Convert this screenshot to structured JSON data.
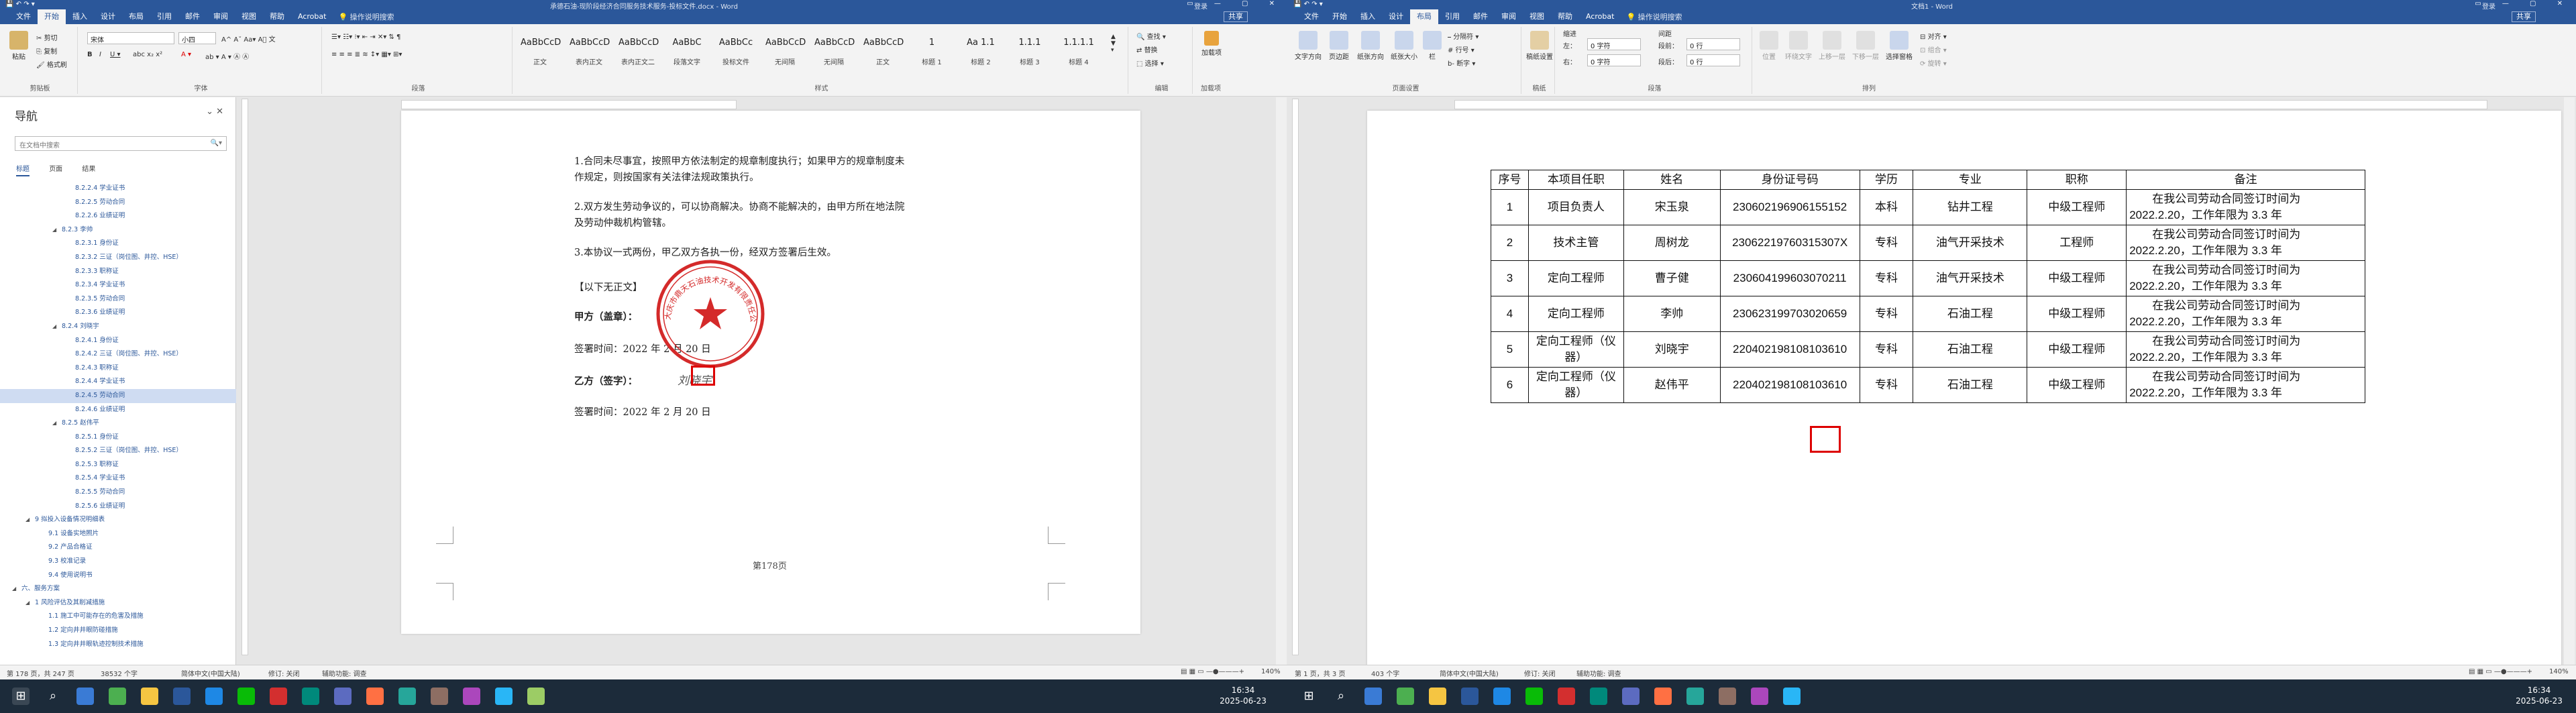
{
  "left": {
    "title": "承德石油-现阶段经济合同服务技术服务-投标文件.docx - Word",
    "login": "登录",
    "share": "共享",
    "tabs": [
      "文件",
      "开始",
      "插入",
      "设计",
      "布局",
      "引用",
      "邮件",
      "审阅",
      "视图",
      "帮助",
      "Acrobat"
    ],
    "tell_me": "操作说明搜索",
    "ribbon": {
      "clipboard": "剪贴板",
      "paste": "粘贴",
      "cut": "剪切",
      "copy": "复制",
      "format_painter": "格式刷",
      "font": "字体",
      "font_name": "宋体",
      "font_size": "小四",
      "paragraph": "段落",
      "styles_label": "样式",
      "styles": [
        {
          "preview": "AaBbCcD",
          "name": "正文"
        },
        {
          "preview": "AaBbCcD",
          "name": "表内正文"
        },
        {
          "preview": "AaBbCcD",
          "name": "表内正文二"
        },
        {
          "preview": "AaBbC",
          "name": "段落文字"
        },
        {
          "preview": "AaBbCc",
          "name": "投标文件"
        },
        {
          "preview": "AaBbCcD",
          "name": "无间隔"
        },
        {
          "preview": "AaBbCcD",
          "name": "无间隔"
        },
        {
          "preview": "AaBbCcD",
          "name": "正文"
        },
        {
          "preview": "1",
          "name": "标题 1"
        },
        {
          "preview": "Aa 1.1",
          "name": "标题 2"
        },
        {
          "preview": "1.1.1",
          "name": "标题 3"
        },
        {
          "preview": "1.1.1.1",
          "name": "标题 4"
        }
      ],
      "editing": "编辑",
      "find": "查找",
      "replace": "替换",
      "select": "选择",
      "addin": "加载项",
      "addin_btn": "加载项"
    },
    "nav": {
      "title": "导航",
      "search_placeholder": "在文档中搜索",
      "tabs": [
        "标题",
        "页面",
        "结果"
      ],
      "items": [
        {
          "text": "8.2.2.4 学业证书",
          "level": 4
        },
        {
          "text": "8.2.2.5 劳动合同",
          "level": 4
        },
        {
          "text": "8.2.2.6 业绩证明",
          "level": 4
        },
        {
          "text": "8.2.3 李帅",
          "level": 3,
          "open": true
        },
        {
          "text": "8.2.3.1 身份证",
          "level": 4
        },
        {
          "text": "8.2.3.2 三证（岗位图、井控、HSE）",
          "level": 4
        },
        {
          "text": "8.2.3.3 职称证",
          "level": 4
        },
        {
          "text": "8.2.3.4 学业证书",
          "level": 4
        },
        {
          "text": "8.2.3.5 劳动合同",
          "level": 4
        },
        {
          "text": "8.2.3.6 业绩证明",
          "level": 4
        },
        {
          "text": "8.2.4 刘晓宇",
          "level": 3,
          "open": true
        },
        {
          "text": "8.2.4.1 身份证",
          "level": 4
        },
        {
          "text": "8.2.4.2 三证（岗位图、井控、HSE）",
          "level": 4
        },
        {
          "text": "8.2.4.3 职称证",
          "level": 4
        },
        {
          "text": "8.2.4.4 学业证书",
          "level": 4
        },
        {
          "text": "8.2.4.5 劳动合同",
          "level": 4,
          "selected": true
        },
        {
          "text": "8.2.4.6 业绩证明",
          "level": 4
        },
        {
          "text": "8.2.5 赵伟平",
          "level": 3,
          "open": true
        },
        {
          "text": "8.2.5.1 身份证",
          "level": 4
        },
        {
          "text": "8.2.5.2 三证（岗位图、井控、HSE）",
          "level": 4
        },
        {
          "text": "8.2.5.3 职称证",
          "level": 4
        },
        {
          "text": "8.2.5.4 学业证书",
          "level": 4
        },
        {
          "text": "8.2.5.5 劳动合同",
          "level": 4
        },
        {
          "text": "8.2.5.6 业绩证明",
          "level": 4
        },
        {
          "text": "9 拟投入设备情况明细表",
          "level": 1,
          "open": true
        },
        {
          "text": "9.1 设备实地照片",
          "level": 2
        },
        {
          "text": "9.2 产品合格证",
          "level": 2
        },
        {
          "text": "9.3 校准记录",
          "level": 2
        },
        {
          "text": "9.4 使用说明书",
          "level": 2
        },
        {
          "text": "六、服务方案",
          "level": 0,
          "open": true
        },
        {
          "text": "1 风险评估及其削减措施",
          "level": 1,
          "open": true
        },
        {
          "text": "1.1 施工中可能存在的危害及措施",
          "level": 2
        },
        {
          "text": "1.2 定向井井眼防碰措施",
          "level": 2
        },
        {
          "text": "1.3 定向井井眼轨迹控制技术措施",
          "level": 2
        }
      ]
    },
    "doc": {
      "paras": [
        "1.合同未尽事宜，按照甲方依法制定的规章制度执行；如果甲方的规章制度未",
        "作规定，则按国家有关法律法规政策执行。",
        "2.双方发生劳动争议的，可以协商解决。协商不能解决的，由甲方所在地法院",
        "及劳动仲裁机构管辖。",
        "3.本协议一式两份，甲乙双方各执一份，经双方签署后生效。"
      ],
      "blank": "【以下无正文】",
      "party_a": "甲方（盖章）：",
      "sign_date_a": "签署时间：2022 年 2 月 20 日",
      "party_b": "乙方（签字）：",
      "signature": "刘晓宇",
      "sign_date_b": "签署时间：2022 年 2 月 20 日",
      "seal_text": "大庆市鼎天石油技术开发有限责任公司",
      "page_number": "第178页"
    },
    "status": {
      "page": "第 178 页，共 247 页",
      "words": "38532 个字",
      "lang": "简体中文(中国大陆)",
      "track": "修订: 关闭",
      "access": "辅助功能: 调查",
      "zoom": "140%"
    }
  },
  "right": {
    "title": "文档1 - Word",
    "login": "登录",
    "share": "共享",
    "tabs": [
      "文件",
      "开始",
      "插入",
      "设计",
      "布局",
      "引用",
      "邮件",
      "审阅",
      "视图",
      "帮助",
      "Acrobat"
    ],
    "active_tab": "布局",
    "tell_me": "操作说明搜索",
    "ribbon": {
      "page_setup": "页面设置",
      "text_direction": "文字方向",
      "margins": "页边距",
      "orientation": "纸张方向",
      "size": "纸张大小",
      "columns": "栏",
      "breaks": "分隔符",
      "line_numbers": "行号",
      "hyphenation": "断字",
      "manuscript": "稿纸设置",
      "manuscript_group": "稿纸",
      "indent": "缩进",
      "spacing": "间距",
      "left": "左：",
      "right": "右：",
      "before": "段前：",
      "after": "段后：",
      "left_val": "0 字符",
      "right_val": "0 字符",
      "before_val": "0 行",
      "after_val": "0 行",
      "paragraph": "段落",
      "arrange": "排列",
      "position": "位置",
      "wrap": "环绕文字",
      "forward": "上移一层",
      "backward": "下移一层",
      "sel_pane": "选择窗格",
      "align": "对齐",
      "group": "组合",
      "rotate": "旋转"
    },
    "table": {
      "headers": [
        "序号",
        "本项目任职",
        "姓名",
        "身份证号码",
        "学历",
        "专业",
        "职称",
        "备注"
      ],
      "rows": [
        [
          "1",
          "项目负责人",
          "宋玉泉",
          "230602196906155152",
          "本科",
          "钻井工程",
          "中级工程师",
          "在我公司劳动合同签订时间为 2022.2.20，工作年限为 3.3 年"
        ],
        [
          "2",
          "技术主管",
          "周树龙",
          "23062219760315307X",
          "专科",
          "油气开采技术",
          "工程师",
          "在我公司劳动合同签订时间为 2022.2.20，工作年限为 3.3 年"
        ],
        [
          "3",
          "定向工程师",
          "曹子健",
          "230604199603070211",
          "专科",
          "油气开采技术",
          "中级工程师",
          "在我公司劳动合同签订时间为 2022.2.20，工作年限为 3.3 年"
        ],
        [
          "4",
          "定向工程师",
          "李帅",
          "230623199703020659",
          "专科",
          "石油工程",
          "中级工程师",
          "在我公司劳动合同签订时间为 2022.2.20，工作年限为 3.3 年"
        ],
        [
          "5",
          "定向工程师（仪器）",
          "刘晓宇",
          "220402198108103610",
          "专科",
          "石油工程",
          "中级工程师",
          "在我公司劳动合同签订时间为 2022.2.20，工作年限为 3.3 年"
        ],
        [
          "6",
          "定向工程师（仪器）",
          "赵伟平",
          "220402198108103610",
          "专科",
          "石油工程",
          "中级工程师",
          "在我公司劳动合同签订时间为 2022.2.20，工作年限为 3.3 年"
        ]
      ]
    },
    "status": {
      "page": "第 1 页，共 3 页",
      "words": "403 个字",
      "lang": "简体中文(中国大陆)",
      "track": "修订: 关闭",
      "access": "辅助功能: 调查",
      "zoom": "140%"
    }
  },
  "taskbar": {
    "time": "16:34",
    "date": "2025-06-23"
  },
  "colors": {
    "word_blue": "#2b579a",
    "seal_red": "#d42a2a",
    "highlight_box": "#dd0000"
  }
}
